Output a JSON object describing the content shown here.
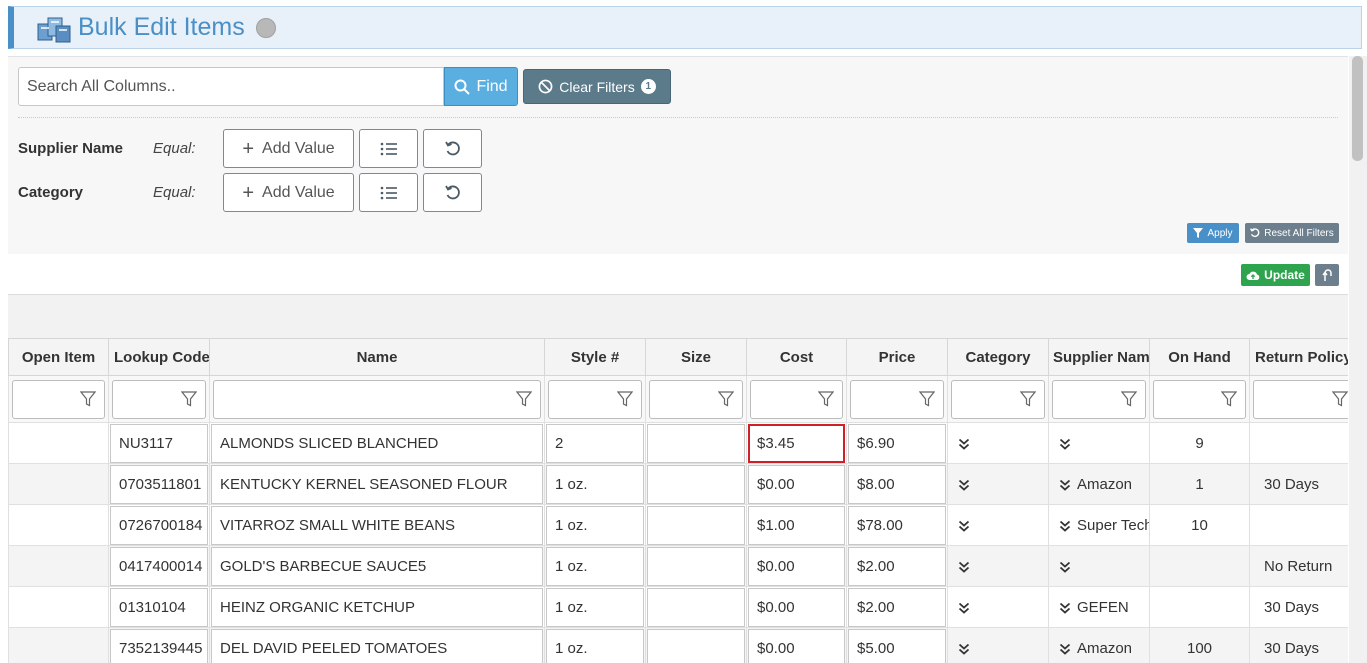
{
  "header": {
    "title": "Bulk Edit Items"
  },
  "search": {
    "placeholder": "Search All Columns..",
    "find_label": "Find",
    "clear_label": "Clear Filters",
    "clear_count": "1"
  },
  "filters": [
    {
      "label": "Supplier Name",
      "operator": "Equal:",
      "add_label": "Add Value"
    },
    {
      "label": "Category",
      "operator": "Equal:",
      "add_label": "Add Value"
    }
  ],
  "actions": {
    "apply_label": "Apply",
    "reset_label": "Reset All Filters",
    "update_label": "Update"
  },
  "colors": {
    "accent": "#4a90c8",
    "update": "#2ea44f",
    "highlight": "#d01f27"
  },
  "grid": {
    "columns": [
      "Open Item",
      "Lookup Code",
      "Name",
      "Style #",
      "Size",
      "Cost",
      "Price",
      "Category",
      "Supplier Name",
      "On Hand",
      "Return Policy"
    ],
    "rows": [
      {
        "lookup": "NU3117",
        "name": "ALMONDS SLICED BLANCHED",
        "style": "2",
        "size": "",
        "cost": "$3.45",
        "price": "$6.90",
        "supplier": "",
        "on_hand": "9",
        "return_policy": ""
      },
      {
        "lookup": "0703511801",
        "name": "KENTUCKY KERNEL SEASONED FLOUR",
        "style": "1 oz.",
        "size": "",
        "cost": "$0.00",
        "price": "$8.00",
        "supplier": "Amazon",
        "on_hand": "1",
        "return_policy": "30 Days"
      },
      {
        "lookup": "0726700184",
        "name": "VITARROZ SMALL WHITE BEANS",
        "style": "1 oz.",
        "size": "",
        "cost": "$1.00",
        "price": "$78.00",
        "supplier": "Super Tech",
        "on_hand": "10",
        "return_policy": ""
      },
      {
        "lookup": "0417400014",
        "name": "GOLD'S BARBECUE SAUCE5",
        "style": "1 oz.",
        "size": "",
        "cost": "$0.00",
        "price": "$2.00",
        "supplier": "",
        "on_hand": "",
        "return_policy": "No Return"
      },
      {
        "lookup": "01310104",
        "name": "HEINZ ORGANIC KETCHUP",
        "style": "1 oz.",
        "size": "",
        "cost": "$0.00",
        "price": "$2.00",
        "supplier": "GEFEN",
        "on_hand": "",
        "return_policy": "30 Days"
      },
      {
        "lookup": "7352139445",
        "name": "DEL DAVID PEELED TOMATOES",
        "style": "1 oz.",
        "size": "",
        "cost": "$0.00",
        "price": "$5.00",
        "supplier": "Amazon",
        "on_hand": "100",
        "return_policy": "30 Days"
      }
    ]
  }
}
